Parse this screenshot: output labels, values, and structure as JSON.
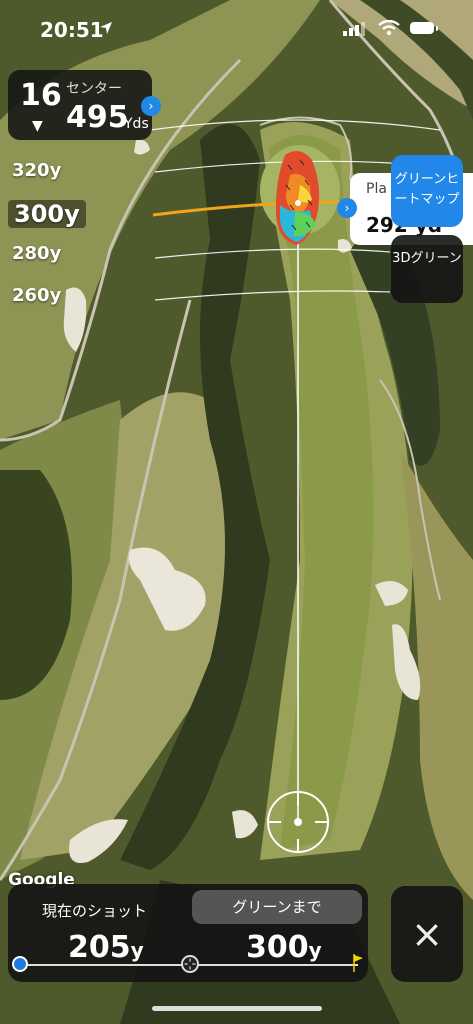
{
  "status": {
    "time": "20:51"
  },
  "hole": {
    "number": "16",
    "label": "センター",
    "yards": "495",
    "unit": "Yds"
  },
  "distances": {
    "d320": "320y",
    "d300": "300y",
    "d280": "280y",
    "d260": "260y"
  },
  "play_card": {
    "label": "Pla",
    "value": "292 yd"
  },
  "buttons": {
    "heatmap": "グリーンヒートマップ",
    "green3d": "3Dグリーン",
    "close": "×"
  },
  "map": {
    "attribution": "Google"
  },
  "bottom": {
    "tab_current": "現在のショット",
    "tab_green": "グリーンまで",
    "current_value": "205",
    "green_value": "300",
    "unit": "y"
  },
  "colors": {
    "accent": "#2188ea",
    "aim_line": "#f2a51a",
    "panel": "#141414"
  }
}
